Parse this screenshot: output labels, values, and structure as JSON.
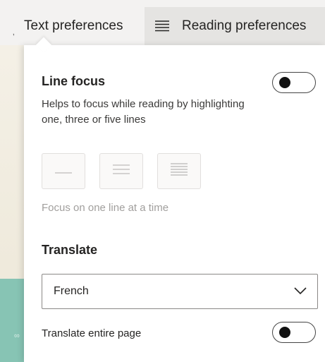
{
  "tabs": {
    "text_preferences": "Text preferences",
    "reading_preferences": "Reading preferences"
  },
  "line_focus": {
    "title": "Line focus",
    "description": "Helps to focus while reading by highlighting one, three or five lines",
    "enabled": false,
    "options": [
      "one-line",
      "three-lines",
      "five-lines"
    ],
    "hint": "Focus on one line at a time"
  },
  "translate": {
    "title": "Translate",
    "language": "French",
    "entire_page_label": "Translate entire page",
    "entire_page_enabled": false
  },
  "icons": {
    "reading_tab": "lines-icon",
    "dropdown": "chevron-down-icon"
  },
  "colors": {
    "panel_bg": "#ffffff",
    "tab_active_bg": "#e5e4e2",
    "hint_text": "#a19f9d",
    "teal_strip": "#87c4b4"
  }
}
